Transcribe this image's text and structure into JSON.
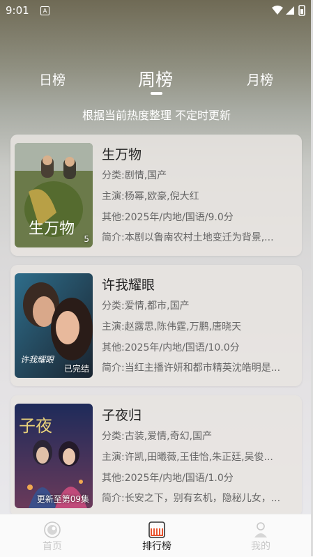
{
  "status": {
    "time": "9:01",
    "app_icon": "A"
  },
  "tabs": {
    "day": "日榜",
    "week": "周榜",
    "month": "月榜",
    "selected": "week"
  },
  "subtitle": "根据当前热度整理 不定时更新",
  "cards": [
    {
      "title": "生万物",
      "badge": "5",
      "category_label": "分类:",
      "category": "剧情,国产",
      "cast_label": "主演:",
      "cast": "杨幂,欧豪,倪大红",
      "other_label": "其他:",
      "other": "2025年/内地/国语/9.0分",
      "intro_label": "简介:",
      "intro": "本剧以鲁南农村土地变迁为背景,..."
    },
    {
      "title": "许我耀眼",
      "badge": "已完结",
      "category_label": "分类:",
      "category": "爱情,都市,国产",
      "cast_label": "主演:",
      "cast": "赵露思,陈伟霆,万鹏,唐晓天",
      "other_label": "其他:",
      "other": "2025年/内地/国语/10.0分",
      "intro_label": "简介:",
      "intro": "当红主播许妍和都市精英沈皓明是..."
    },
    {
      "title": "子夜归",
      "badge": "更新至第09集",
      "category_label": "分类:",
      "category": "古装,爱情,奇幻,国产",
      "cast_label": "主演:",
      "cast": "许凯,田曦薇,王佳怡,朱正廷,吴俊...",
      "other_label": "其他:",
      "other": "2025年/内地/国语/1.0分",
      "intro_label": "简介:",
      "intro": "长安之下，别有玄机，隐秘儿女，..."
    }
  ],
  "nav": {
    "home": "首页",
    "rank": "排行榜",
    "mine": "我的",
    "active": "rank"
  },
  "colors": {
    "active_text": "#222222",
    "inactive_text": "#c8c8c8",
    "rank_icon": "#e8542f"
  }
}
